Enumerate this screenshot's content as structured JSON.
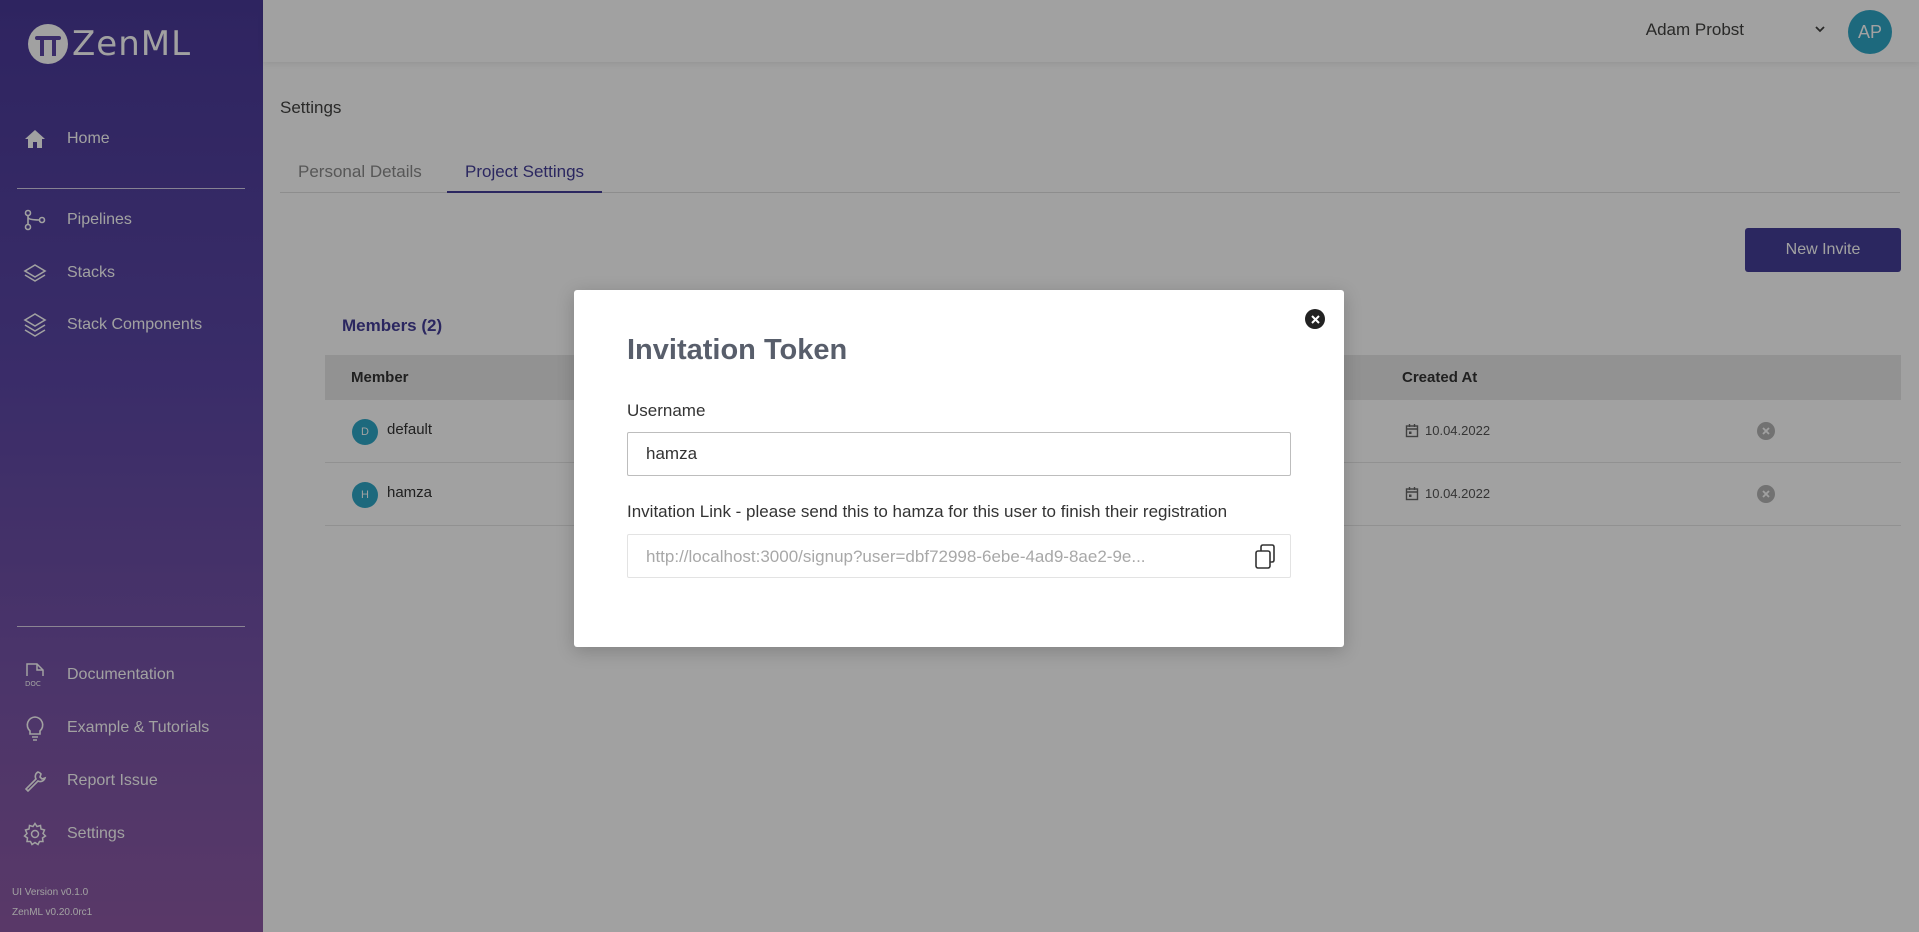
{
  "app": {
    "name": "ZenML"
  },
  "sidebar": {
    "items": [
      {
        "label": "Home",
        "icon": "home-icon"
      },
      {
        "label": "Pipelines",
        "icon": "pipelines-icon"
      },
      {
        "label": "Stacks",
        "icon": "stacks-icon"
      },
      {
        "label": "Stack Components",
        "icon": "stack-components-icon"
      }
    ],
    "bottom_items": [
      {
        "label": "Documentation",
        "icon": "doc-icon"
      },
      {
        "label": "Example & Tutorials",
        "icon": "lightbulb-icon"
      },
      {
        "label": "Report Issue",
        "icon": "wrench-icon"
      },
      {
        "label": "Settings",
        "icon": "gear-icon"
      }
    ],
    "ui_version": "UI Version v0.1.0",
    "zenml_version": "ZenML v0.20.0rc1"
  },
  "header": {
    "user_name": "Adam Probst",
    "avatar_initials": "AP",
    "avatar_color": "#2ea6c6"
  },
  "page": {
    "title": "Settings",
    "tabs": [
      {
        "label": "Personal Details",
        "active": false
      },
      {
        "label": "Project Settings",
        "active": true
      }
    ],
    "new_invite_label": "New Invite",
    "members_title": "Members (2)",
    "columns": {
      "member": "Member",
      "created_at": "Created At"
    },
    "members": [
      {
        "initial": "D",
        "name": "default",
        "created": "10.04.2022"
      },
      {
        "initial": "H",
        "name": "hamza",
        "created": "10.04.2022"
      }
    ]
  },
  "modal": {
    "title": "Invitation Token",
    "username_label": "Username",
    "username_value": "hamza",
    "link_label": "Invitation Link - please send this to hamza for this user to finish their registration",
    "link_value": "http://localhost:3000/signup?user=dbf72998-6ebe-4ad9-8ae2-9e..."
  },
  "colors": {
    "primary": "#443e99",
    "sidebar_top": "#4a3a99",
    "sidebar_bottom": "#8e5aa5",
    "avatar": "#2ea6c6"
  }
}
